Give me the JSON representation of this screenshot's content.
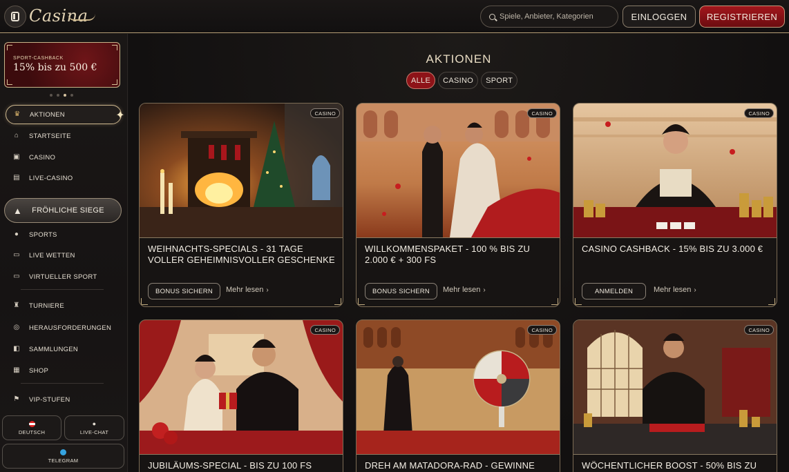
{
  "header": {
    "logo": "Casina",
    "search_placeholder": "Spiele, Anbieter, Kategorien",
    "login_label": "EINLOGGEN",
    "register_label": "REGISTRIEREN"
  },
  "sidebar": {
    "promo": {
      "eyebrow": "SPORT-CASHBACK",
      "title": "15% bis zu 500 €"
    },
    "carousel_dots": 4,
    "carousel_active": 2,
    "items": [
      {
        "label": "AKTIONEN",
        "icon": "crown-icon"
      },
      {
        "label": "STARTSEITE",
        "icon": "home-icon"
      },
      {
        "label": "CASINO",
        "icon": "cards-icon"
      },
      {
        "label": "LIVE-CASINO",
        "icon": "live-cards-icon"
      },
      {
        "label": "FRÖHLICHE SIEGE",
        "icon": "christmas-tree-icon"
      },
      {
        "label": "SPORTS",
        "icon": "soccer-ball-icon"
      },
      {
        "label": "LIVE WETTEN",
        "icon": "live-badge-icon"
      },
      {
        "label": "VIRTUELLER SPORT",
        "icon": "monitor-icon"
      },
      {
        "label": "TURNIERE",
        "icon": "trophy-icon"
      },
      {
        "label": "HERAUSFORDERUNGEN",
        "icon": "target-icon"
      },
      {
        "label": "SAMMLUNGEN",
        "icon": "collection-icon"
      },
      {
        "label": "SHOP",
        "icon": "shop-icon"
      },
      {
        "label": "VIP-STUFEN",
        "icon": "vip-icon"
      }
    ],
    "language_label": "DEUTSCH",
    "livechat_label": "LIVE-CHAT",
    "telegram_label": "TELEGRAM"
  },
  "main": {
    "title": "AKTIONEN",
    "filters": [
      "ALLE",
      "CASINO",
      "SPORT"
    ],
    "active_filter": "ALLE",
    "more_label": "Mehr lesen",
    "cards": [
      {
        "badge": "CASINO",
        "title": "WEIHNACHTS-SPECIALS - 31 TAGE VOLLER GEHEIMNISVOLLER GESCHENKE",
        "button": "BONUS SICHERN"
      },
      {
        "badge": "CASINO",
        "title": "WILLKOMMENSPAKET - 100 % BIS ZU 2.000 € + 300 FS",
        "button": "BONUS SICHERN"
      },
      {
        "badge": "CASINO",
        "title": "CASINO CASHBACK - 15% BIS ZU 3.000 €",
        "button": "ANMELDEN"
      },
      {
        "badge": "CASINO",
        "title": "JUBILÄUMS-SPECIAL - BIS ZU 100 FS",
        "button": ""
      },
      {
        "badge": "CASINO",
        "title": "DREH AM MATADORA-RAD - GEWINNE",
        "button": ""
      },
      {
        "badge": "CASINO",
        "title": "WÖCHENTLICHER BOOST - 50% BIS ZU",
        "button": ""
      }
    ]
  },
  "colors": {
    "accent_gold": "#c9b489",
    "accent_red": "#8e1318",
    "background": "#141212"
  }
}
